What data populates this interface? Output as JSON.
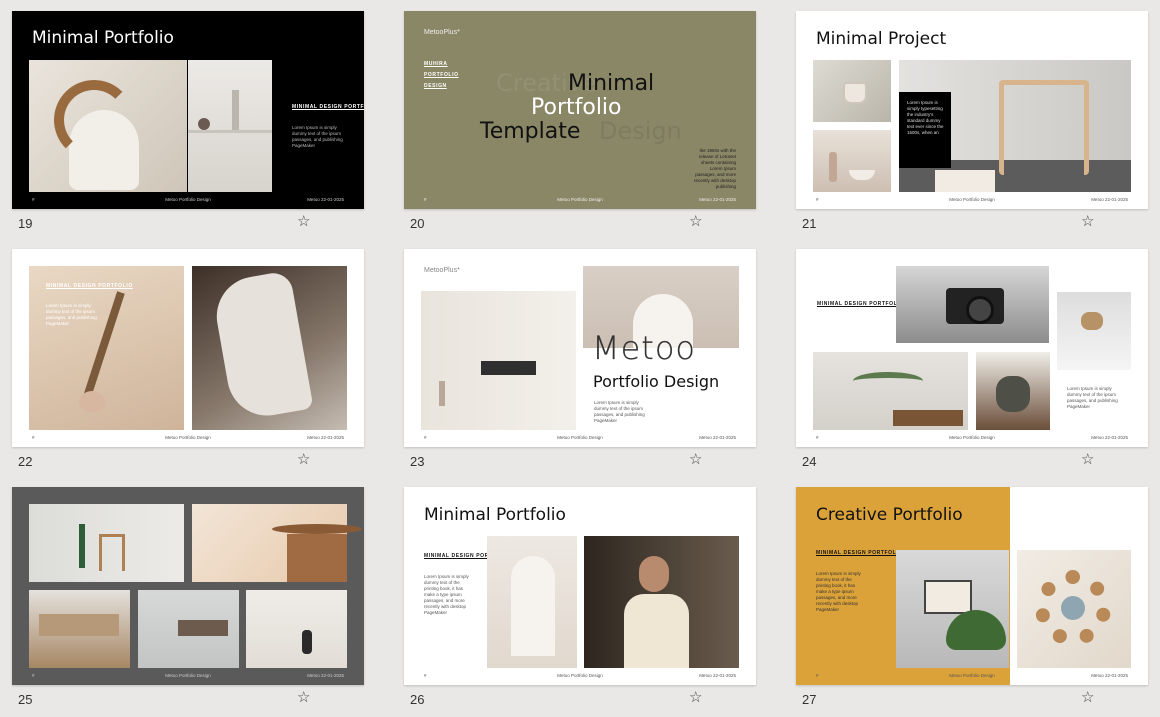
{
  "footer": {
    "left": "#",
    "center": "Metoo Portfolio Design",
    "right": "Metoo",
    "date": "22-01-2025"
  },
  "star_glyph": "☆",
  "slides": {
    "s19": {
      "num": "19",
      "title": "Minimal Portfolio",
      "caption": "MINIMAL DESIGN PORTFOLIO",
      "bullets": [
        "Lorem Ipsum is simply",
        "dummy text of the ipsum",
        "passages, and publishing",
        "PageMaker"
      ]
    },
    "s20": {
      "num": "20",
      "logo": "MetooPlus*",
      "caption1": "MUHIRA",
      "caption2": "PORTFOLIO",
      "caption3": "DESIGN",
      "title1": "Minimal",
      "title2": "Portfolio",
      "title3": "Template",
      "ghost1": "Creative",
      "ghost2": "Design",
      "para": "the 1960s with the release of Letraset sheets containing Lorem Ipsum passages, and more recently with desktop publishing"
    },
    "s21": {
      "num": "21",
      "title": "Minimal Project",
      "para": "Lorem Ipsum is simply typesetting the industry's standard dummy text ever since the 1500s, when an"
    },
    "s22": {
      "num": "22",
      "caption": "MINIMAL DESIGN PORTFOLIO",
      "bullets": [
        "Lorem Ipsum is simply",
        "dummy text of the ipsum",
        "passages, and publishing",
        "PageMaker"
      ]
    },
    "s23": {
      "num": "23",
      "logo": "MetooPlus*",
      "big": "Metoo",
      "sub": "Portfolio Design",
      "bullets": [
        "Lorem Ipsum is simply",
        "dummy text of the ipsum",
        "passages, and publishing",
        "PageMaker"
      ]
    },
    "s24": {
      "num": "24",
      "caption": "MINIMAL DESIGN PORTFOLIO",
      "bullets": [
        "Lorem Ipsum is simply",
        "dummy text of the ipsum",
        "passages, and publishing",
        "PageMaker"
      ]
    },
    "s25": {
      "num": "25"
    },
    "s26": {
      "num": "26",
      "title": "Minimal Portfolio",
      "caption": "MINIMAL DESIGN PORTFOLIO",
      "para": "Lorem Ipsum is simply dummy text of the printing book, it has make a type ipsum passages, and more recently with desktop PageMaker"
    },
    "s27": {
      "num": "27",
      "title": "Creative Portfolio",
      "caption": "MINIMAL DESIGN PORTFOLIO",
      "para": "Lorem Ipsum is simply dummy text of the printing book, it has make a type ipsum passages, and more recently with desktop PageMaker"
    }
  },
  "colors": {
    "olive": "#8a8766",
    "mustard": "#dca23a",
    "charcoal": "#5a5a5a",
    "black": "#000000"
  }
}
